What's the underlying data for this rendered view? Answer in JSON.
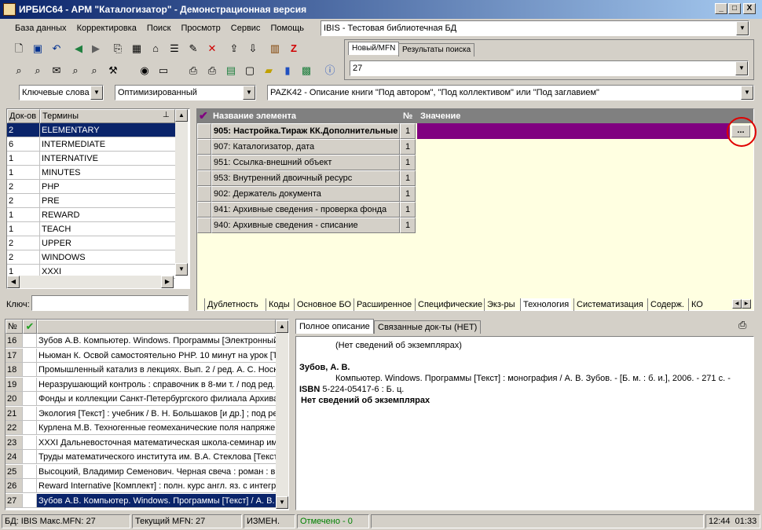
{
  "window": {
    "title": "ИРБИС64 - АРМ \"Каталогизатор\" - Демонстрационная версия",
    "btn_min": "_",
    "btn_max": "□",
    "btn_close": "X"
  },
  "menu": [
    "База данных",
    "Корректировка",
    "Поиск",
    "Просмотр",
    "Сервис",
    "Помощь"
  ],
  "db_select": {
    "value": "IBIS - Тестовая библиотечная БД"
  },
  "mfn_tabs": [
    "Новый/MFN",
    "Результаты поиска"
  ],
  "mfn_value": "27",
  "search_mode": {
    "value": "Ключевые слова"
  },
  "opt_mode": {
    "value": "Оптимизированный"
  },
  "worksheet": {
    "value": "PAZK42 - Описание книги \"Под автором\", \"Под коллективом\" или \"Под заглавием\""
  },
  "terms": {
    "col_count": "Док-ов",
    "col_term": "Термины",
    "rows": [
      {
        "count": "2",
        "term": "ELEMENTARY"
      },
      {
        "count": "6",
        "term": "INTERMEDIATE"
      },
      {
        "count": "1",
        "term": "INTERNATIVE"
      },
      {
        "count": "1",
        "term": "MINUTES"
      },
      {
        "count": "2",
        "term": "PHP"
      },
      {
        "count": "2",
        "term": "PRE"
      },
      {
        "count": "1",
        "term": "REWARD"
      },
      {
        "count": "1",
        "term": "TEACH"
      },
      {
        "count": "2",
        "term": "UPPER"
      },
      {
        "count": "2",
        "term": "WINDOWS"
      },
      {
        "count": "1",
        "term": "XXXI"
      }
    ],
    "key_label": "Ключ:",
    "key_value": ""
  },
  "elements": {
    "col_name": "Название элемента",
    "col_num": "№",
    "col_value": "Значение",
    "ellipsis": "...",
    "rows": [
      {
        "name": "905: Настройка.Тираж КК.Дополнительные",
        "num": "1",
        "bold": true
      },
      {
        "name": "907: Каталогизатор, дата",
        "num": "1"
      },
      {
        "name": "951: Ссылка-внешний объект",
        "num": "1"
      },
      {
        "name": "953: Внутренний двоичный ресурс",
        "num": "1"
      },
      {
        "name": "902: Держатель документа",
        "num": "1"
      },
      {
        "name": "941: Архивные сведения - проверка фонда",
        "num": "1"
      },
      {
        "name": "940: Архивные сведения - списание",
        "num": "1"
      }
    ]
  },
  "bottom_tabs": [
    "Дублетность",
    "Коды",
    "Основное БО",
    "Расширенное",
    "Специфические",
    "Экз-ры",
    "Технология",
    "Систематизация",
    "Содерж.",
    "КО"
  ],
  "docs": {
    "col_num": "№",
    "rows": [
      {
        "n": "16",
        "t": "Зубов А.В. Компьютер. Windows. Программы [Электронный"
      },
      {
        "n": "17",
        "t": "Ньюман К. Освой самостоятельно PHP. 10 минут на урок [Те"
      },
      {
        "n": "18",
        "t": "Промышленный катализ в лекциях. Вып. 2 / ред. А. С. Носко"
      },
      {
        "n": "19",
        "t": "Неразрушающий контроль : справочник в 8-ми т. / под ред. В"
      },
      {
        "n": "20",
        "t": "Фонды и коллекции Санкт-Петербургского филиала Архива Р"
      },
      {
        "n": "21",
        "t": "Экология [Текст] : учебник / В. Н. Большаков [и др.] ; под ред"
      },
      {
        "n": "22",
        "t": "Курлена М.В. Техногенные геомеханические поля напряжен"
      },
      {
        "n": "23",
        "t": "XXXI Дальневосточная математическая школа-семинар име"
      },
      {
        "n": "24",
        "t": "Труды математического института им. В.А. Стеклова [Текст"
      },
      {
        "n": "25",
        "t": "Высоцкий, Владимир Семенович. Черная свеча : роман : в 2"
      },
      {
        "n": "26",
        "t": "Reward Internative [Комплект] : полн. курс англ. яз. с интегр"
      },
      {
        "n": "27",
        "t": "Зубов А.В. Компьютер. Windows. Программы [Текст] / А. В. З"
      }
    ]
  },
  "desc_tabs": [
    "Полное описание",
    "Связанные док-ты (НЕТ)"
  ],
  "description": {
    "line1": "(Нет сведений об экземплярах)",
    "author": "Зубов, А. В.",
    "body": "Компьютер. Windows. Программы [Текст] : монография / А. В. Зубов. - [Б. м. : б. и.], 2006. - 271 с. -",
    "isbn_label": "ISBN",
    "isbn": "5-224-05417-6 : Б. ц.",
    "noinst": "Нет сведений об экземплярах"
  },
  "status": {
    "db": "БД: IBIS Макс.MFN: 27",
    "cur": "Текущий MFN: 27",
    "changed": "ИЗМЕН.",
    "marked": "Отмечено - 0",
    "time": "12:44",
    "time2": "01:33"
  },
  "colors": {
    "selected": "#0a246a",
    "purple": "#800080",
    "yellow": "#ffffe1",
    "highlight_circle": "#e00000",
    "marked_text": "#008000"
  }
}
